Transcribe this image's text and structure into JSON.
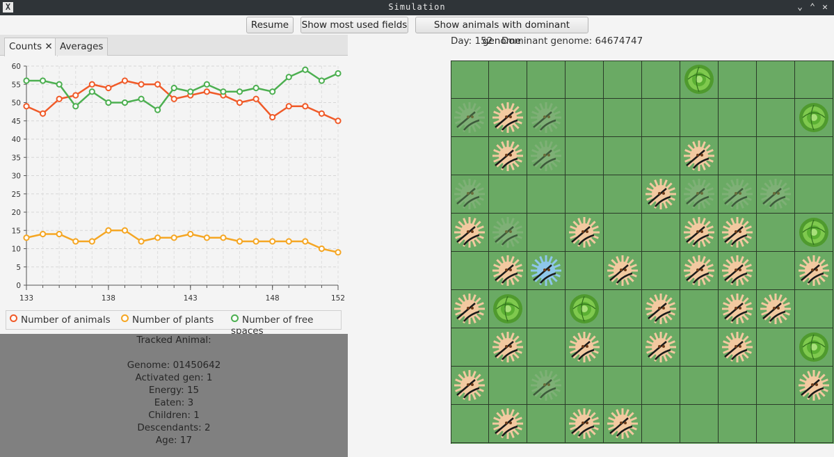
{
  "window": {
    "title": "Simulation",
    "app_icon": "X",
    "controls": [
      "minimize-icon",
      "maximize-icon",
      "close-icon"
    ]
  },
  "toolbar": {
    "resume_label": "Resume",
    "most_used_label": "Show most used fields",
    "dominant_label": "Show animals with dominant genome"
  },
  "status": {
    "day": "Day: 152",
    "dominant": "Dominant genome: 64674747"
  },
  "tabs": [
    {
      "label": "Counts ✕",
      "active": true
    },
    {
      "label": "Averages",
      "active": false
    }
  ],
  "chart_data": {
    "type": "line",
    "x": [
      133,
      134,
      135,
      136,
      137,
      138,
      139,
      140,
      141,
      142,
      143,
      144,
      145,
      146,
      147,
      148,
      149,
      150,
      151,
      152
    ],
    "xticks": [
      "133",
      "138",
      "143",
      "148",
      "152"
    ],
    "yticks": [
      "0",
      "5",
      "10",
      "15",
      "20",
      "25",
      "30",
      "35",
      "40",
      "45",
      "50",
      "55",
      "60"
    ],
    "ylim": [
      0,
      60
    ],
    "grid": true,
    "legend": "bottom",
    "series": [
      {
        "name": "Number of animals",
        "color": "#f05a28",
        "values": [
          49,
          47,
          51,
          52,
          55,
          54,
          56,
          55,
          55,
          51,
          52,
          53,
          52,
          50,
          51,
          46,
          49,
          49,
          47,
          45
        ]
      },
      {
        "name": "Number of plants",
        "color": "#f5a623",
        "values": [
          13,
          14,
          14,
          12,
          12,
          15,
          15,
          12,
          13,
          13,
          14,
          13,
          13,
          12,
          12,
          12,
          12,
          12,
          10,
          9
        ]
      },
      {
        "name": "Number of free spaces",
        "color": "#4caf50",
        "values": [
          56,
          56,
          55,
          49,
          53,
          50,
          50,
          51,
          48,
          54,
          53,
          55,
          53,
          53,
          54,
          53,
          57,
          59,
          56,
          58
        ]
      }
    ]
  },
  "tracked": {
    "title": "Tracked Animal:",
    "genome": "Genome: 01450642",
    "activated": "Activated gen: 1",
    "energy": "Energy: 15",
    "eaten": "Eaten: 3",
    "children": "Children: 1",
    "descendants": "Descendants: 2",
    "age": "Age: 17"
  },
  "map": {
    "size": 10,
    "colors": {
      "grass": "#6aaa64",
      "plant": "#5bb033",
      "animal": "#f2c9a0",
      "tracked": "#8ec7ea",
      "faded": "#8fb585"
    },
    "objects": [
      {
        "r": 0,
        "c": 6,
        "t": "plant"
      },
      {
        "r": 1,
        "c": 0,
        "t": "faded"
      },
      {
        "r": 1,
        "c": 1,
        "t": "animal"
      },
      {
        "r": 1,
        "c": 2,
        "t": "faded"
      },
      {
        "r": 1,
        "c": 9,
        "t": "plant"
      },
      {
        "r": 2,
        "c": 1,
        "t": "animal"
      },
      {
        "r": 2,
        "c": 2,
        "t": "faded"
      },
      {
        "r": 2,
        "c": 6,
        "t": "animal"
      },
      {
        "r": 3,
        "c": 0,
        "t": "faded"
      },
      {
        "r": 3,
        "c": 5,
        "t": "animal"
      },
      {
        "r": 3,
        "c": 6,
        "t": "faded"
      },
      {
        "r": 3,
        "c": 7,
        "t": "faded"
      },
      {
        "r": 3,
        "c": 8,
        "t": "faded"
      },
      {
        "r": 4,
        "c": 0,
        "t": "animal"
      },
      {
        "r": 4,
        "c": 1,
        "t": "faded"
      },
      {
        "r": 4,
        "c": 3,
        "t": "animal"
      },
      {
        "r": 4,
        "c": 6,
        "t": "animal"
      },
      {
        "r": 4,
        "c": 7,
        "t": "animal"
      },
      {
        "r": 4,
        "c": 9,
        "t": "plant"
      },
      {
        "r": 5,
        "c": 1,
        "t": "animal"
      },
      {
        "r": 5,
        "c": 2,
        "t": "tracked"
      },
      {
        "r": 5,
        "c": 4,
        "t": "animal"
      },
      {
        "r": 5,
        "c": 6,
        "t": "animal"
      },
      {
        "r": 5,
        "c": 7,
        "t": "animal"
      },
      {
        "r": 5,
        "c": 9,
        "t": "animal"
      },
      {
        "r": 6,
        "c": 0,
        "t": "animal"
      },
      {
        "r": 6,
        "c": 1,
        "t": "plant"
      },
      {
        "r": 6,
        "c": 3,
        "t": "plant"
      },
      {
        "r": 6,
        "c": 5,
        "t": "animal"
      },
      {
        "r": 6,
        "c": 7,
        "t": "animal"
      },
      {
        "r": 6,
        "c": 8,
        "t": "animal"
      },
      {
        "r": 7,
        "c": 1,
        "t": "animal"
      },
      {
        "r": 7,
        "c": 3,
        "t": "animal"
      },
      {
        "r": 7,
        "c": 5,
        "t": "animal"
      },
      {
        "r": 7,
        "c": 7,
        "t": "animal"
      },
      {
        "r": 7,
        "c": 9,
        "t": "plant"
      },
      {
        "r": 8,
        "c": 0,
        "t": "animal"
      },
      {
        "r": 8,
        "c": 2,
        "t": "faded"
      },
      {
        "r": 8,
        "c": 9,
        "t": "animal"
      },
      {
        "r": 9,
        "c": 1,
        "t": "animal"
      },
      {
        "r": 9,
        "c": 3,
        "t": "animal"
      },
      {
        "r": 9,
        "c": 4,
        "t": "animal"
      }
    ]
  }
}
